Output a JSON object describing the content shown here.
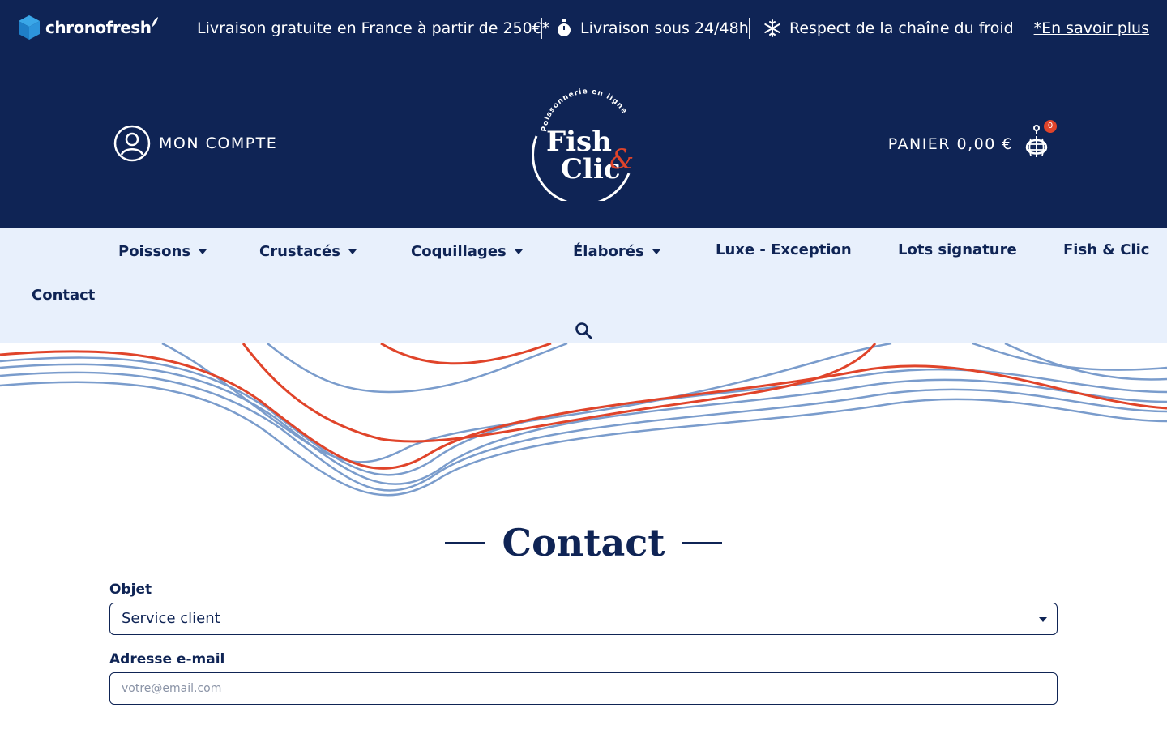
{
  "topbar": {
    "brand": "chronofresh",
    "free_delivery": "Livraison gratuite en France à partir de 250€*",
    "delivery_time": "Livraison sous 24/48h",
    "cold_chain": "Respect de la chaîne du froid",
    "learn_more": "*En savoir plus"
  },
  "header": {
    "account_label": "MON COMPTE",
    "cart_label": "PANIER 0,00 €",
    "cart_count": "0",
    "logo": {
      "arc_text": "Poissonnerie en ligne",
      "line1": "Fish",
      "line2": "Clic",
      "amp": "&"
    }
  },
  "nav": {
    "items": [
      {
        "label": "Poissons",
        "dropdown": true
      },
      {
        "label": "Crustacés",
        "dropdown": true
      },
      {
        "label": "Coquillages",
        "dropdown": true
      },
      {
        "label": "Élaborés",
        "dropdown": true
      },
      {
        "label": "Luxe - Exception",
        "dropdown": false
      },
      {
        "label": "Lots signature",
        "dropdown": false
      },
      {
        "label": "Fish & Clic",
        "dropdown": false
      },
      {
        "label": "Contact",
        "dropdown": false
      }
    ]
  },
  "page": {
    "title": "Contact"
  },
  "form": {
    "subject_label": "Objet",
    "subject_value": "Service client",
    "email_label": "Adresse e-mail",
    "email_placeholder": "votre@email.com"
  },
  "colors": {
    "navy": "#0f2455",
    "nav_bg": "#e8f0fc",
    "accent_red": "#e0442a",
    "wave_blue": "#7a9ccc"
  }
}
